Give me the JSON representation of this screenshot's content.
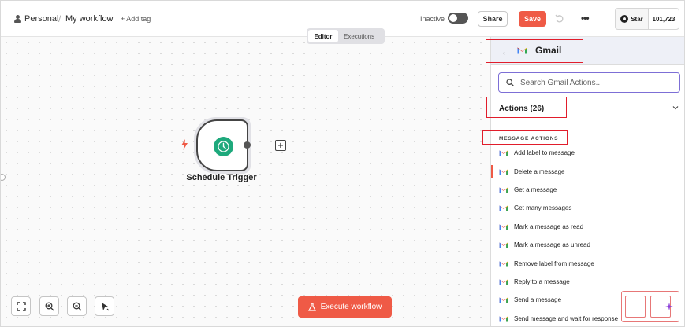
{
  "header": {
    "breadcrumb_owner": "Personal",
    "breadcrumb_separator": "/",
    "workflow_title": "My workflow",
    "add_tag_label": "+ Add tag",
    "active_toggle_label": "Inactive",
    "share_label": "Share",
    "save_label": "Save",
    "more_label": "•••",
    "github_star_label": "Star",
    "github_star_count": "101,723"
  },
  "canvas": {
    "tabs": [
      {
        "label": "Editor",
        "active": true
      },
      {
        "label": "Executions",
        "active": false
      }
    ],
    "node": {
      "label": "Schedule Trigger",
      "icon": "clock-icon",
      "icon_color": "#1ea97c"
    },
    "toolbar": {
      "fit_view": "fit-view-icon",
      "zoom_in": "zoom-in-icon",
      "zoom_out": "zoom-out-icon",
      "tidy": "tidy-icon"
    },
    "execute_label": "Execute workflow"
  },
  "panel": {
    "title": "Gmail",
    "search_placeholder": "Search Gmail Actions...",
    "actions_header": "Actions (26)",
    "section_label": "MESSAGE ACTIONS",
    "actions": [
      "Add label to message",
      "Delete a message",
      "Get a message",
      "Get many messages",
      "Mark a message as read",
      "Mark a message as unread",
      "Remove label from message",
      "Reply to a message",
      "Send a message",
      "Send message and wait for response"
    ]
  },
  "colors": {
    "accent": "#ef5a46",
    "search_border": "#7d6fd6",
    "annotation": "#e11d2b",
    "trigger_green": "#1ea97c"
  }
}
